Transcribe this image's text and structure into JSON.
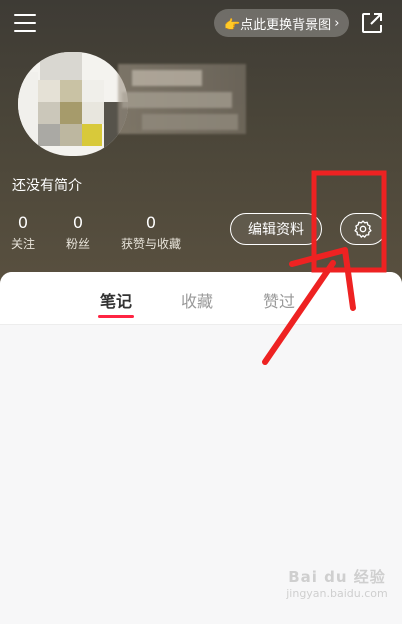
{
  "header": {
    "bg_button_label": "👉点此更换背景图",
    "bg_button_chevron": "›"
  },
  "profile": {
    "bio": "还没有简介",
    "stats": [
      {
        "value": "0",
        "label": "关注"
      },
      {
        "value": "0",
        "label": "粉丝"
      },
      {
        "value": "0",
        "label": "获赞与收藏"
      }
    ],
    "edit_button_label": "编辑资料"
  },
  "tabs": [
    {
      "label": "笔记",
      "active": true
    },
    {
      "label": "收藏",
      "active": false
    },
    {
      "label": "赞过",
      "active": false
    }
  ],
  "watermark": {
    "logo": "Bai du 经验",
    "url": "jingyan.baidu.com"
  },
  "colors": {
    "accent": "#ff2442",
    "annotation": "#ee2222",
    "header_bg": "#4b4639"
  },
  "icons": [
    "menu-icon",
    "share-icon",
    "gear-icon",
    "pointing-hand-icon"
  ]
}
